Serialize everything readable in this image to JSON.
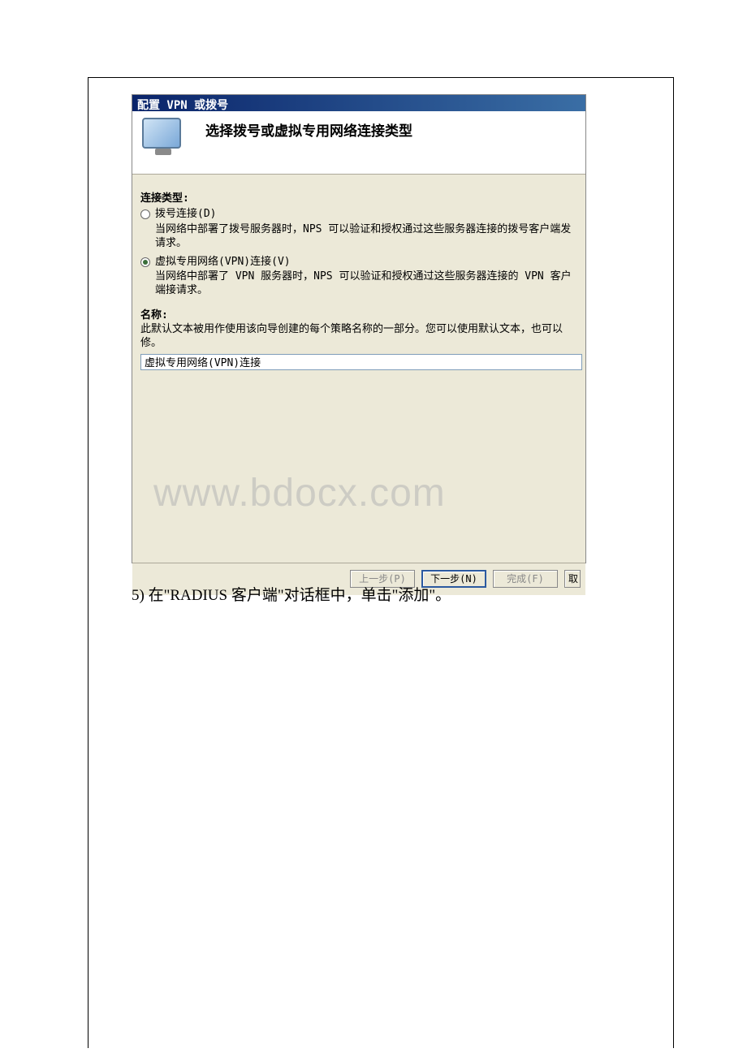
{
  "dialog": {
    "title": "配置 VPN 或拨号",
    "header_title": "选择拨号或虚拟专用网络连接类型",
    "connection_type_label": "连接类型:",
    "options": [
      {
        "label": "拨号连接(D)",
        "desc": "当网络中部署了拨号服务器时，NPS 可以验证和授权通过这些服务器连接的拨号客户端发请求。",
        "selected": false
      },
      {
        "label": "虚拟专用网络(VPN)连接(V)",
        "desc": "当网络中部署了 VPN 服务器时，NPS 可以验证和授权通过这些服务器连接的 VPN 客户端接请求。",
        "selected": true
      }
    ],
    "name_label": "名称:",
    "name_desc": "此默认文本被用作使用该向导创建的每个策略名称的一部分。您可以使用默认文本，也可以修。",
    "name_value": "虚拟专用网络(VPN)连接",
    "buttons": {
      "prev": "上一步(P)",
      "next": "下一步(N)",
      "finish": "完成(F)",
      "cancel": "取"
    }
  },
  "watermark": "www.bdocx.com",
  "doc_line": "5) 在\"RADIUS 客户端\"对话框中，单击\"添加\"。"
}
